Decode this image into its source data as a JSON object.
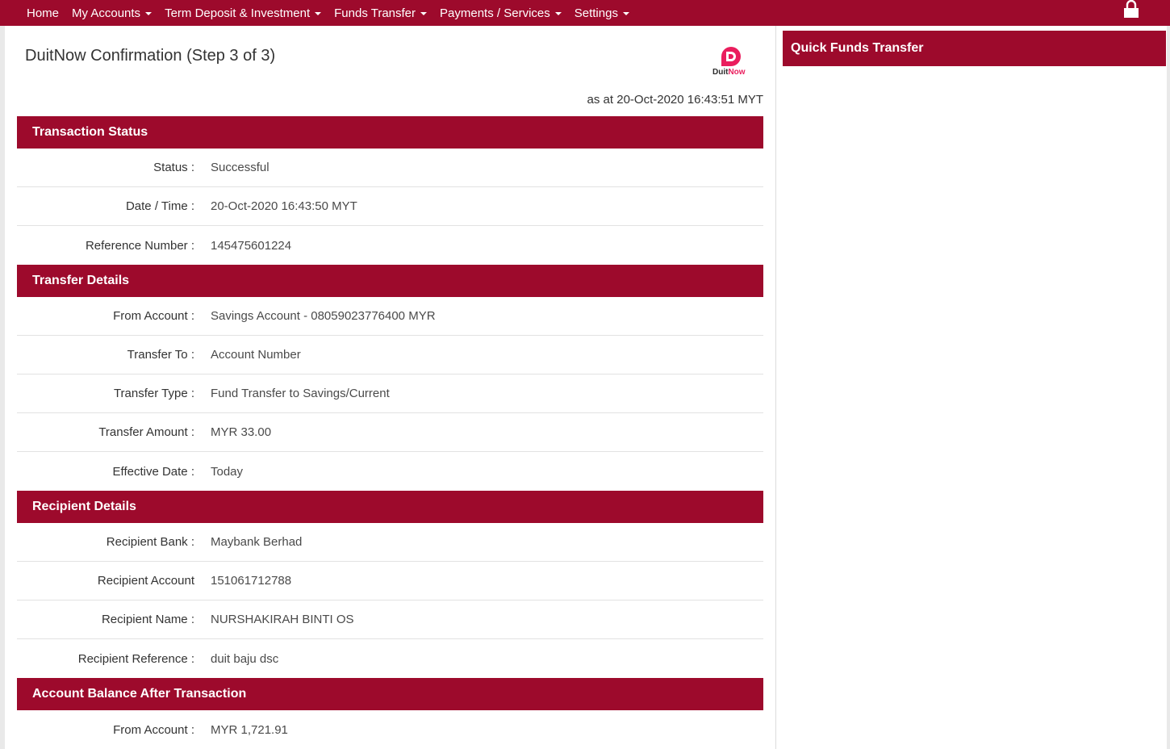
{
  "nav": {
    "items": [
      {
        "label": "Home",
        "dropdown": false
      },
      {
        "label": "My Accounts",
        "dropdown": true
      },
      {
        "label": "Term Deposit & Investment",
        "dropdown": true
      },
      {
        "label": "Funds Transfer",
        "dropdown": true
      },
      {
        "label": "Payments / Services",
        "dropdown": true
      },
      {
        "label": "Settings",
        "dropdown": true
      }
    ],
    "lock_icon": "lock-icon"
  },
  "page": {
    "title": "DuitNow Confirmation (Step 3 of 3)",
    "timestamp": "as at 20-Oct-2020 16:43:51 MYT",
    "logo_text_1": "Duit",
    "logo_text_2": "Now"
  },
  "sections": {
    "status": {
      "header": "Transaction Status",
      "rows": [
        {
          "label": "Status :",
          "value": "Successful"
        },
        {
          "label": "Date / Time :",
          "value": "20-Oct-2020 16:43:50 MYT"
        },
        {
          "label": "Reference Number :",
          "value": "145475601224"
        }
      ]
    },
    "transfer": {
      "header": "Transfer Details",
      "rows": [
        {
          "label": "From Account :",
          "value": "Savings Account - 08059023776400 MYR"
        },
        {
          "label": "Transfer To :",
          "value": "Account Number"
        },
        {
          "label": "Transfer Type :",
          "value": "Fund Transfer to Savings/Current"
        },
        {
          "label": "Transfer Amount :",
          "value": "MYR 33.00"
        },
        {
          "label": "Effective Date :",
          "value": "Today"
        }
      ]
    },
    "recipient": {
      "header": "Recipient Details",
      "rows": [
        {
          "label": "Recipient Bank :",
          "value": "Maybank Berhad"
        },
        {
          "label": "Recipient Account",
          "value": "151061712788"
        },
        {
          "label": "Recipient Name :",
          "value": "NURSHAKIRAH BINTI OS"
        },
        {
          "label": "Recipient Reference :",
          "value": "duit baju dsc"
        }
      ]
    },
    "balance": {
      "header": "Account Balance After Transaction",
      "rows": [
        {
          "label": "From Account :",
          "value": "MYR 1,721.91"
        }
      ]
    }
  },
  "sidebar": {
    "quick_transfer_title": "Quick Funds Transfer"
  },
  "colors": {
    "brand": "#9d0a2c",
    "duitnow_pink": "#ea1d5d"
  }
}
